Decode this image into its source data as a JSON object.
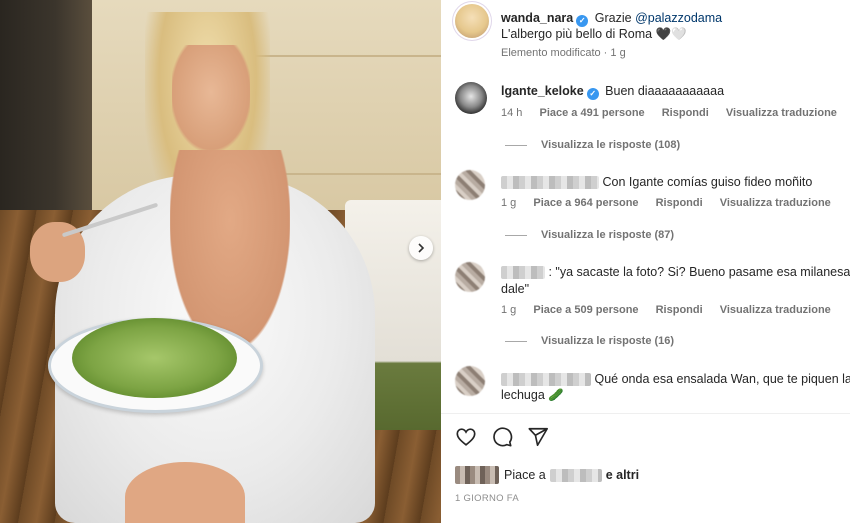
{
  "post": {
    "author": "wanda_nara",
    "caption_prefix": "Grazie",
    "caption_mention": "@palazzodama",
    "caption_line2": "L'albergo più bello di Roma 🖤🤍",
    "edited_label": "Elemento modificato",
    "edited_time": "1 g"
  },
  "comments": [
    {
      "username": "lgante_keloke",
      "text": "Buen diaaaaaaaaaaa",
      "time": "14 h",
      "likes": "Piace a 491 persone",
      "reply": "Rispondi",
      "translate": "Visualizza traduzione",
      "view_replies": "Visualizza le risposte (108)"
    },
    {
      "username": "",
      "text": "Con Igante comías guiso fideo moñito",
      "time": "1 g",
      "likes": "Piace a 964 persone",
      "reply": "Rispondi",
      "translate": "Visualizza traduzione",
      "view_replies": "Visualizza le risposte (87)"
    },
    {
      "username": "",
      "text_line1": ": \"ya sacaste la foto? Si? Bueno pasame esa milanesa",
      "text_line2": "dale\"",
      "time": "1 g",
      "likes": "Piace a 509 persone",
      "reply": "Rispondi",
      "translate": "Visualizza traduzione",
      "view_replies": "Visualizza le risposte (16)"
    },
    {
      "username": "",
      "text_line1": "Qué onda esa ensalada Wan, que te piquen la",
      "text_line2": "lechuga 🥒"
    }
  ],
  "footer": {
    "likes_prefix": "Piace a",
    "likes_suffix": "e altri",
    "timestamp": "1 GIORNO FA"
  },
  "icons": {
    "heart": "heart-icon",
    "comment": "comment-icon",
    "share": "share-icon",
    "verified": "verified-badge-icon",
    "carousel": "chevron-right-icon"
  },
  "colors": {
    "verified": "#3897f0",
    "mention": "#00376b",
    "secondary_text": "#737373"
  }
}
